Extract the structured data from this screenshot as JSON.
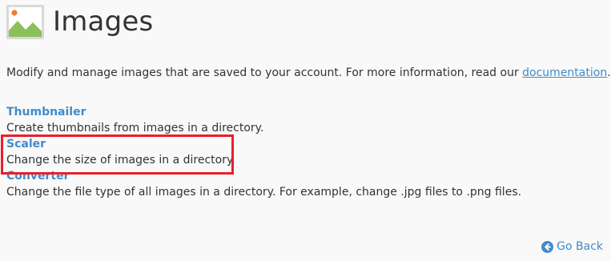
{
  "header": {
    "title": "Images",
    "icon": "images-icon"
  },
  "intro": {
    "text": "Modify and manage images that are saved to your account. For more information, read our ",
    "link_label": "documentation",
    "trailing": "."
  },
  "features": [
    {
      "label": "Thumbnailer",
      "description": "Create thumbnails from images in a directory."
    },
    {
      "label": "Scaler",
      "description": "Change the size of images in a directory."
    },
    {
      "label": "Converter",
      "description": "Change the file type of all images in a directory. For example, change .jpg files to .png files."
    }
  ],
  "footer": {
    "back_label": "Go Back",
    "back_icon": "arrow-left-circle-icon"
  },
  "colors": {
    "link": "#428bca",
    "text": "#333333",
    "background": "#f9f9f9",
    "highlight": "#e8202a",
    "icon_green": "#8bbf5a",
    "icon_sun": "#f07a30"
  }
}
